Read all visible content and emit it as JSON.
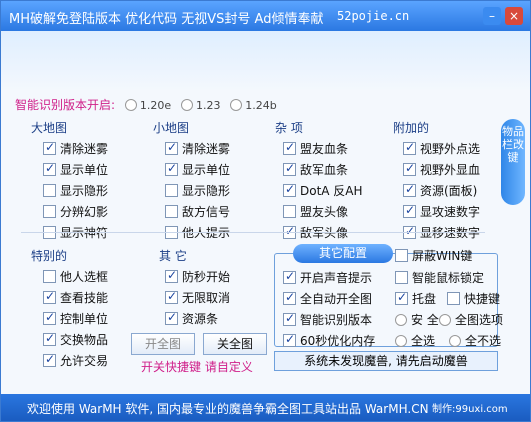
{
  "window": {
    "title": "MH破解免登陆版本 优化代码 无视VS封号  Ad倾情奉献",
    "site": "52pojie.cn",
    "min_label": "–",
    "close_label": "×"
  },
  "version": {
    "label": "智能识别版本开启:",
    "options": [
      {
        "label": "1.20e",
        "selected": false
      },
      {
        "label": "1.23",
        "selected": false
      },
      {
        "label": "1.24b",
        "selected": false
      }
    ]
  },
  "groups": {
    "big_map": {
      "title": "大地图",
      "items": [
        {
          "label": "清除迷雾",
          "checked": true
        },
        {
          "label": "显示单位",
          "checked": true
        },
        {
          "label": "显示隐形",
          "checked": false
        },
        {
          "label": "分辨幻影",
          "checked": false
        },
        {
          "label": "显示神符",
          "checked": false
        }
      ]
    },
    "mini_map": {
      "title": "小地图",
      "items": [
        {
          "label": "清除迷雾",
          "checked": true
        },
        {
          "label": "显示单位",
          "checked": true
        },
        {
          "label": "显示隐形",
          "checked": false
        },
        {
          "label": "敌方信号",
          "checked": false
        },
        {
          "label": "他人提示",
          "checked": false
        }
      ]
    },
    "misc": {
      "title": "杂 项",
      "items": [
        {
          "label": "盟友血条",
          "checked": true
        },
        {
          "label": "敌军血条",
          "checked": true
        },
        {
          "label": "DotA 反AH",
          "checked": true
        },
        {
          "label": "盟友头像",
          "checked": false
        },
        {
          "label": "敌军头像",
          "checked": true
        }
      ]
    },
    "extra": {
      "title": "附加的",
      "items": [
        {
          "label": "视野外点选",
          "checked": true
        },
        {
          "label": "视野外显血",
          "checked": true
        },
        {
          "label": "资源(面板)",
          "checked": true
        },
        {
          "label": "显攻速数字",
          "checked": true
        },
        {
          "label": "显移速数字",
          "checked": true
        }
      ]
    },
    "special": {
      "title": "特别的",
      "items": [
        {
          "label": "他人选框",
          "checked": false
        },
        {
          "label": "查看技能",
          "checked": true
        },
        {
          "label": "控制单位",
          "checked": true
        },
        {
          "label": "交换物品",
          "checked": true
        },
        {
          "label": "允许交易",
          "checked": true
        }
      ]
    },
    "other": {
      "title": "其 它",
      "items": [
        {
          "label": "防秒开始",
          "checked": true
        },
        {
          "label": "无限取消",
          "checked": true
        },
        {
          "label": "资源条",
          "checked": true
        }
      ]
    }
  },
  "side_button": {
    "label": "物品栏改键"
  },
  "config": {
    "title": "其它配置",
    "shield_win": {
      "label": "屏蔽WIN键",
      "checked": false
    },
    "left": [
      {
        "label": "开启声音提示",
        "checked": true
      },
      {
        "label": "全自动开全图",
        "checked": true
      },
      {
        "label": "智能识别版本",
        "checked": true
      },
      {
        "label": "60秒优化内存",
        "checked": true
      }
    ],
    "smart_mouse": {
      "label": "智能鼠标锁定",
      "checked": false
    },
    "tray": {
      "label": "托盘",
      "checked": true
    },
    "quick_key": {
      "label": "快捷键",
      "checked": false
    },
    "safe": {
      "label": "安 全",
      "selected": false
    },
    "full_opts": {
      "label": "全图选项",
      "selected": false
    },
    "select_all": {
      "label": "全选",
      "selected": false
    },
    "select_none": {
      "label": "全不选",
      "selected": false
    }
  },
  "buttons": {
    "open_map": "开全图",
    "close_map": "关全图"
  },
  "hotkey_text": "开关快捷键  请自定义",
  "status_text": "系统未发现魔兽, 请先启动魔兽",
  "footer": {
    "welcome": "欢迎使用 WarMH 软件, 国内最专业的魔兽争霸全图工具站出品 WarMH.CN",
    "maker": "制作:99uxi.com"
  }
}
